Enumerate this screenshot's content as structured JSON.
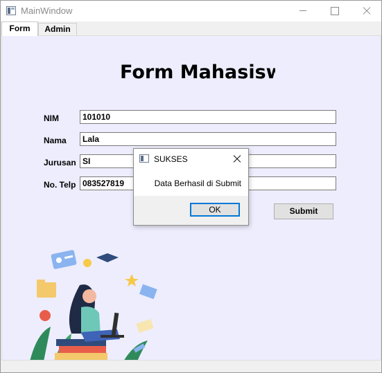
{
  "window": {
    "title": "MainWindow"
  },
  "tabs": [
    {
      "label": "Form"
    },
    {
      "label": "Admin"
    }
  ],
  "form": {
    "title": "Form Mahasiswa",
    "fields": [
      {
        "label": "NIM",
        "value": "101010"
      },
      {
        "label": "Nama",
        "value": "Lala"
      },
      {
        "label": "Jurusan",
        "value": "SI"
      },
      {
        "label": "No. Telp",
        "value": "083527819"
      }
    ],
    "submit_label": "Submit"
  },
  "dialog": {
    "title": "SUKSES",
    "message": "Data Berhasil di Submit",
    "ok_label": "OK"
  },
  "colors": {
    "panel_bg": "#ededfd",
    "focus_border": "#0078d7"
  }
}
